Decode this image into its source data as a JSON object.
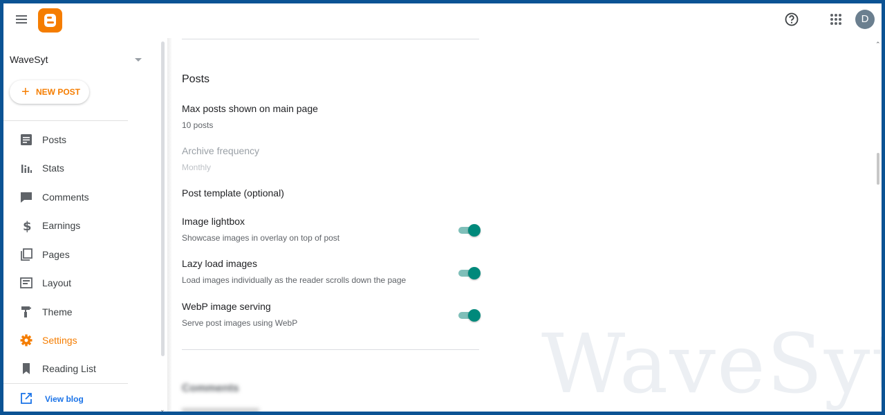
{
  "topbar": {
    "menu_icon": "hamburger-menu-icon",
    "logo_icon": "blogger-logo-icon",
    "help_icon": "help-icon",
    "apps_icon": "apps-grid-icon",
    "avatar_letter": "D",
    "brand_color": "#f57d00"
  },
  "sidebar": {
    "blog_name": "WaveSyt",
    "new_post_plus": "+",
    "new_post_label": "NEW POST",
    "items": [
      {
        "label": "Posts",
        "icon": "posts-icon",
        "active": false
      },
      {
        "label": "Stats",
        "icon": "stats-icon",
        "active": false
      },
      {
        "label": "Comments",
        "icon": "comments-icon",
        "active": false
      },
      {
        "label": "Earnings",
        "icon": "dollar-icon",
        "active": false
      },
      {
        "label": "Pages",
        "icon": "pages-icon",
        "active": false
      },
      {
        "label": "Layout",
        "icon": "layout-icon",
        "active": false
      },
      {
        "label": "Theme",
        "icon": "paint-roller-icon",
        "active": false
      },
      {
        "label": "Settings",
        "icon": "gear-icon",
        "active": true
      },
      {
        "label": "Reading List",
        "icon": "bookmark-icon",
        "active": false
      }
    ],
    "view_blog_label": "View blog",
    "active_color": "#f57d00",
    "link_color": "#1a73e8"
  },
  "main": {
    "section_title": "Posts",
    "settings": [
      {
        "title": "Max posts shown on main page",
        "subtitle": "10 posts",
        "disabled": false
      },
      {
        "title": "Archive frequency",
        "subtitle": "Monthly",
        "disabled": true
      },
      {
        "title": "Post template (optional)",
        "subtitle": "",
        "disabled": false
      }
    ],
    "toggles": [
      {
        "title": "Image lightbox",
        "subtitle": "Showcase images in overlay on top of post",
        "on": true
      },
      {
        "title": "Lazy load images",
        "subtitle": "Load images individually as the reader scrolls down the page",
        "on": true
      },
      {
        "title": "WebP image serving",
        "subtitle": "Serve post images using WebP",
        "on": true
      }
    ],
    "next_section_title": "Comments",
    "watermark": "WaveSyt",
    "toggle_color": "#00897b"
  }
}
